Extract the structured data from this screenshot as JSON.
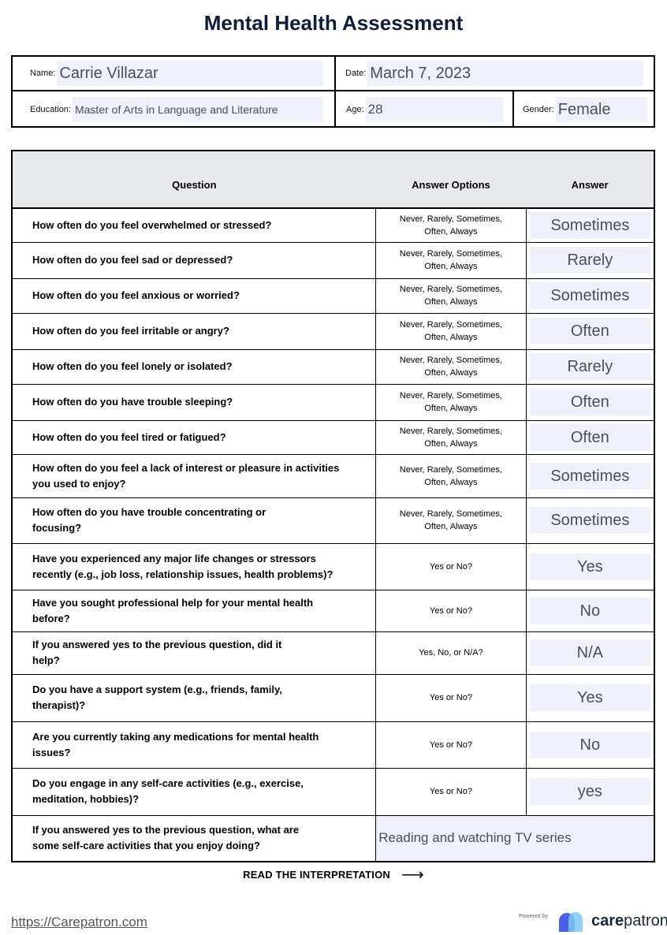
{
  "title": "Mental Health Assessment",
  "patient": {
    "name_label": "Name:",
    "name": "Carrie Villazar",
    "date_label": "Date:",
    "date": "March 7, 2023",
    "education_label": "Education:",
    "education": "Master of Arts in Language and Literature",
    "age_label": "Age:",
    "age": "28",
    "gender_label": "Gender:",
    "gender": "Female"
  },
  "table": {
    "headers": {
      "question": "Question",
      "options": "Answer Options",
      "answer": "Answer"
    },
    "rows": [
      {
        "q1": "How often do you feel overwhelmed or stressed?",
        "q2": "",
        "o1": "Never, Rarely, Sometimes,",
        "o2": "Often, Always",
        "answer": "Sometimes"
      },
      {
        "q1": "How often do you feel sad or depressed?",
        "q2": "",
        "o1": "Never, Rarely, Sometimes,",
        "o2": "Often, Always",
        "answer": "Rarely"
      },
      {
        "q1": "How often do you feel anxious or worried?",
        "q2": "",
        "o1": "Never, Rarely, Sometimes,",
        "o2": "Often, Always",
        "answer": "Sometimes"
      },
      {
        "q1": "How often do you feel irritable or angry?",
        "q2": "",
        "o1": "Never, Rarely, Sometimes,",
        "o2": "Often, Always",
        "answer": "Often"
      },
      {
        "q1": "How often do you feel lonely or isolated?",
        "q2": "",
        "o1": "Never, Rarely, Sometimes,",
        "o2": "Often, Always",
        "answer": "Rarely"
      },
      {
        "q1": "How often do you have trouble sleeping?",
        "q2": "",
        "o1": "Never, Rarely, Sometimes,",
        "o2": "Often, Always",
        "answer": "Often"
      },
      {
        "q1": "How often do you feel tired or fatigued?",
        "q2": "",
        "o1": "Never, Rarely, Sometimes,",
        "o2": "Often, Always",
        "answer": "Often"
      },
      {
        "q1": "How often do you feel a lack of interest or pleasure in activities",
        "q2": "you used to enjoy?",
        "o1": "Never, Rarely, Sometimes,",
        "o2": "Often, Always",
        "answer": "Sometimes"
      },
      {
        "q1": "How often do you have trouble concentrating or",
        "q2": "focusing?",
        "o1": "Never, Rarely, Sometimes,",
        "o2": "Often, Always",
        "answer": "Sometimes"
      },
      {
        "q1": "Have you experienced any major life changes or stressors",
        "q2": "recently (e.g., job loss, relationship issues, health problems)?",
        "o1": "Yes or No?",
        "o2": "",
        "answer": "Yes"
      },
      {
        "q1": "Have you sought professional help for your mental health",
        "q2": "before?",
        "o1": "Yes or No?",
        "o2": "",
        "answer": "No"
      },
      {
        "q1": "If you answered yes to the previous question, did it",
        "q2": "help?",
        "o1": "Yes, No, or N/A?",
        "o2": "",
        "answer": "N/A"
      },
      {
        "q1": "Do you have a support system (e.g., friends, family,",
        "q2": "therapist)?",
        "o1": "Yes or No?",
        "o2": "",
        "answer": "Yes"
      },
      {
        "q1": "Are you currently taking any medications for mental health",
        "q2": "issues?",
        "o1": "Yes or No?",
        "o2": "",
        "answer": "No"
      },
      {
        "q1": "Do you engage in any self-care activities (e.g., exercise,",
        "q2": "meditation, hobbies)?",
        "o1": "Yes or No?",
        "o2": "",
        "answer": "yes"
      }
    ],
    "final_row": {
      "q1": "If you answered yes to the previous question, what are",
      "q2": "some self-care activities that you enjoy doing?",
      "answer": "Reading and watching TV series"
    }
  },
  "interpretation_link": "READ THE INTERPRETATION",
  "interpretation_arrow": "⟶",
  "footer": {
    "url": "https://Carepatron.com",
    "powered_by": "Powered by",
    "brand_bold": "care",
    "brand_rest": "patron"
  }
}
